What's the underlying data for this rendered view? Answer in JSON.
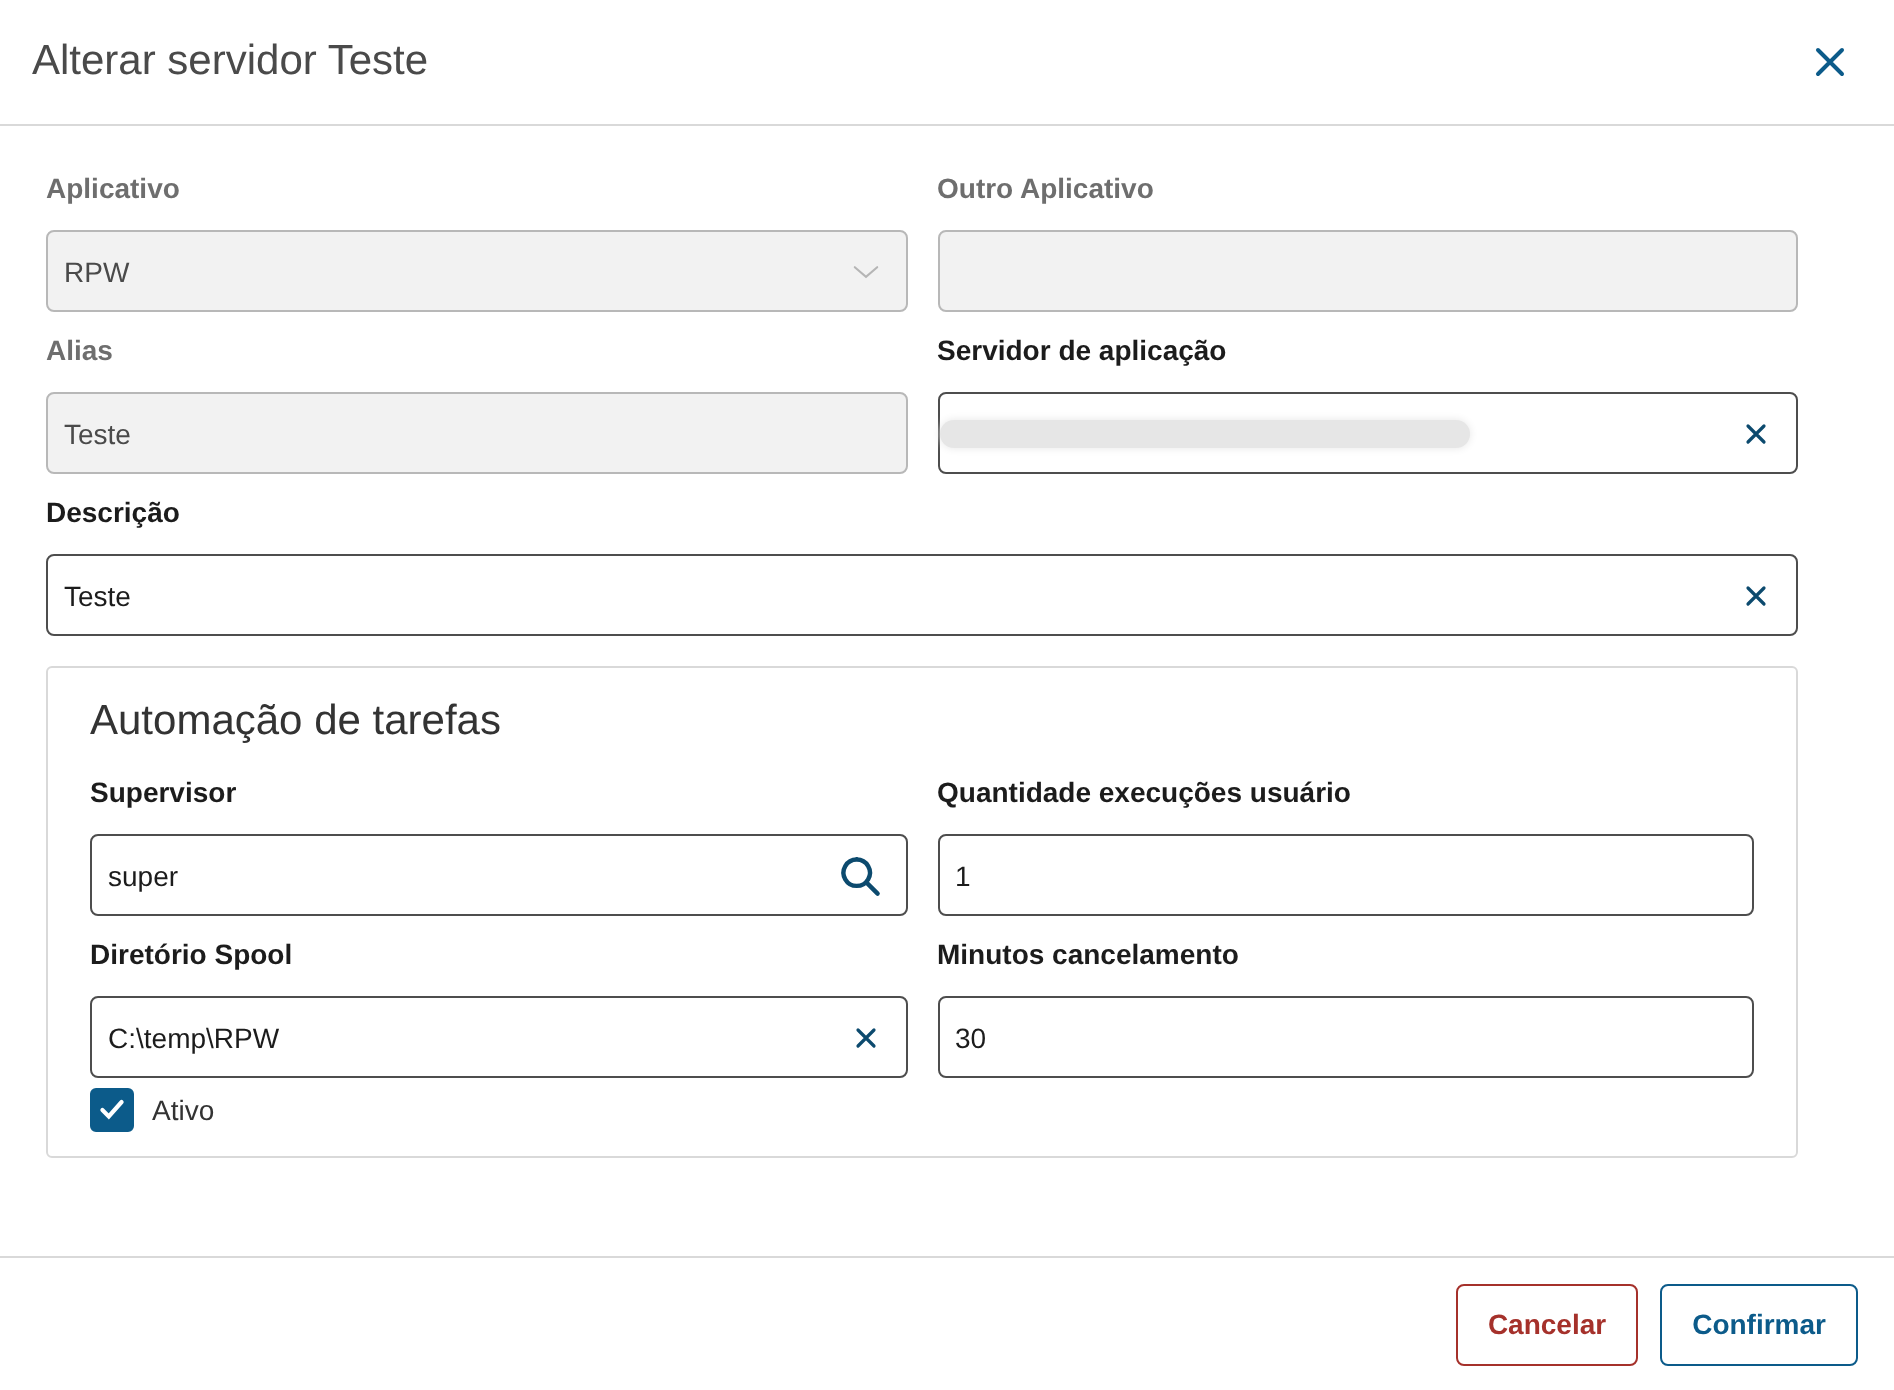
{
  "dialog": {
    "title": "Alterar servidor Teste"
  },
  "fields": [
    {
      "label": "Aplicativo",
      "kind": "select",
      "value": "RPW",
      "disabled": true
    },
    {
      "label": "Outro Aplicativo",
      "kind": "text",
      "disabled": true
    },
    {
      "label": "Alias",
      "kind": "text",
      "value": "Teste",
      "disabled": true
    },
    {
      "label": "Servidor de aplicação",
      "kind": "clearable",
      "redacted": true,
      "disabled": false
    }
  ],
  "description": {
    "label": "Descrição",
    "kind": "clearable",
    "value": "Teste",
    "disabled": false
  },
  "group": {
    "title": "Automação de tarefas",
    "fields": [
      {
        "label": "Supervisor",
        "kind": "search",
        "value": "super",
        "disabled": false
      },
      {
        "label": "Quantidade execuções usuário",
        "kind": "text",
        "value": "1",
        "disabled": false
      },
      {
        "label": "Diretório Spool",
        "kind": "clearable",
        "value": "C:\\temp\\RPW",
        "disabled": false
      },
      {
        "label": "Minutos cancelamento",
        "kind": "text",
        "value": "30",
        "disabled": false
      }
    ],
    "checkbox": {
      "label": "Ativo",
      "checked": true
    }
  },
  "buttons": [
    {
      "label": "Cancelar",
      "kind": "cancel"
    },
    {
      "label": "Confirmar",
      "kind": "confirm"
    }
  ]
}
